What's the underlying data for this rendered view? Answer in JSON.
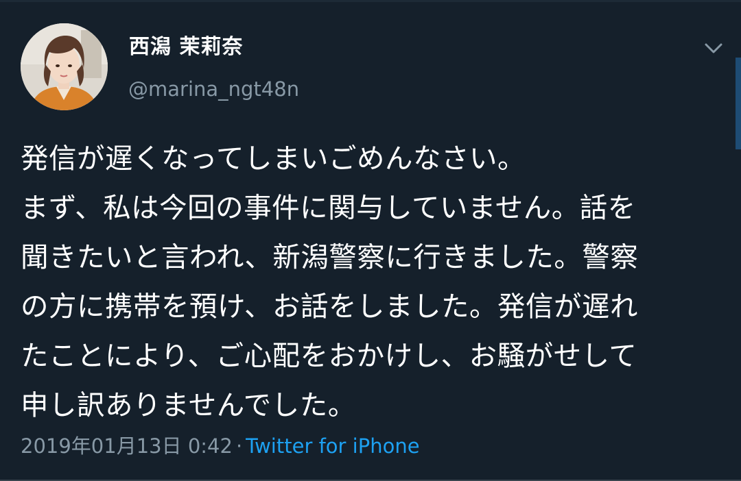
{
  "user": {
    "display_name": "西潟 茉莉奈",
    "handle": "@marina_ngt48n"
  },
  "tweet": {
    "lines": [
      "発信が遅くなってしまいごめんなさい。",
      "まず、私は今回の事件に関与していません。話を",
      "聞きたいと言われ、新潟警察に行きました。警察",
      "の方に携帯を預け、お話をしました。発信が遅れ",
      "たことにより、ご心配をおかけし、お騒がせして",
      "申し訳ありませんでした。"
    ],
    "timestamp": "2019年01月13日 0:42",
    "separator": "·",
    "source": "Twitter for iPhone"
  },
  "icons": {
    "menu": "chevron-down-icon",
    "avatar": "profile-photo"
  },
  "colors": {
    "background": "#15202b",
    "primary_text": "#ffffff",
    "secondary_text": "#8899a6",
    "link": "#1da1f2"
  }
}
